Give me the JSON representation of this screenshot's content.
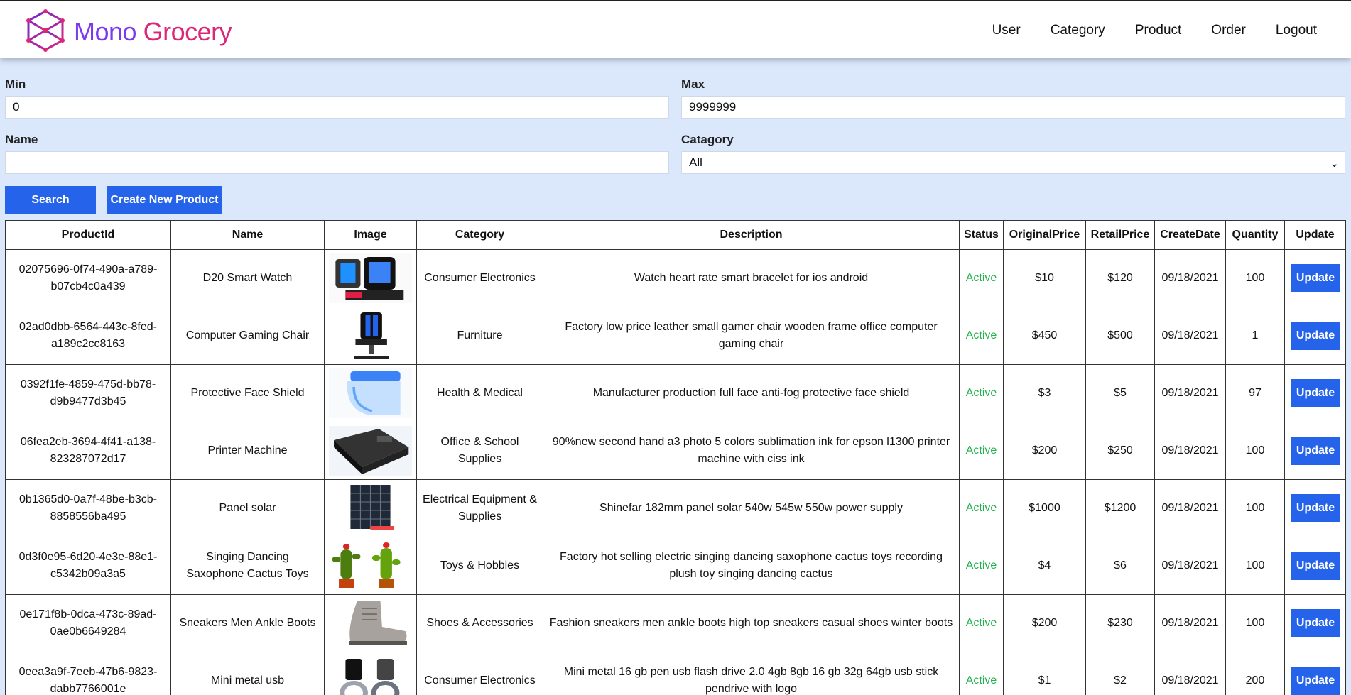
{
  "brand": {
    "part1": "Mono",
    "part2": "Grocery"
  },
  "nav": [
    "User",
    "Category",
    "Product",
    "Order",
    "Logout"
  ],
  "filters": {
    "min_label": "Min",
    "min_value": "0",
    "max_label": "Max",
    "max_value": "9999999",
    "name_label": "Name",
    "name_value": "",
    "category_label": "Catagory",
    "category_value": "All"
  },
  "buttons": {
    "search": "Search",
    "create": "Create New Product"
  },
  "table": {
    "headers": [
      "ProductId",
      "Name",
      "Image",
      "Category",
      "Description",
      "Status",
      "OriginalPrice",
      "RetailPrice",
      "CreateDate",
      "Quantity",
      "Update"
    ],
    "update_label": "Update",
    "rows": [
      {
        "id": "02075696-0f74-490a-a789-b07cb4c0a439",
        "name": "D20 Smart Watch",
        "image": "smartwatch",
        "category": "Consumer Electronics",
        "description": "Watch heart rate smart bracelet for ios android",
        "status": "Active",
        "original": "$10",
        "retail": "$120",
        "date": "09/18/2021",
        "qty": "100"
      },
      {
        "id": "02ad0dbb-6564-443c-8fed-a189c2cc8163",
        "name": "Computer Gaming Chair",
        "image": "gaming-chair",
        "category": "Furniture",
        "description": "Factory low price leather small gamer chair wooden frame office computer gaming chair",
        "status": "Active",
        "original": "$450",
        "retail": "$500",
        "date": "09/18/2021",
        "qty": "1"
      },
      {
        "id": "0392f1fe-4859-475d-bb78-d9b9477d3b45",
        "name": "Protective Face Shield",
        "image": "face-shield",
        "category": "Health & Medical",
        "description": "Manufacturer production full face anti-fog protective face shield",
        "status": "Active",
        "original": "$3",
        "retail": "$5",
        "date": "09/18/2021",
        "qty": "97"
      },
      {
        "id": "06fea2eb-3694-4f41-a138-823287072d17",
        "name": "Printer Machine",
        "image": "printer",
        "category": "Office & School Supplies",
        "description": "90%new second hand a3 photo 5 colors sublimation ink for epson l1300 printer machine with ciss ink",
        "status": "Active",
        "original": "$200",
        "retail": "$250",
        "date": "09/18/2021",
        "qty": "100"
      },
      {
        "id": "0b1365d0-0a7f-48be-b3cb-8858556ba495",
        "name": "Panel solar",
        "image": "solar-panel",
        "category": "Electrical Equipment & Supplies",
        "description": "Shinefar 182mm panel solar 540w 545w 550w power supply",
        "status": "Active",
        "original": "$1000",
        "retail": "$1200",
        "date": "09/18/2021",
        "qty": "100"
      },
      {
        "id": "0d3f0e95-6d20-4e3e-88e1-c5342b09a3a5",
        "name": "Singing Dancing Saxophone Cactus Toys",
        "image": "cactus-toys",
        "category": "Toys & Hobbies",
        "description": "Factory hot selling electric singing dancing saxophone cactus toys recording plush toy singing dancing cactus",
        "status": "Active",
        "original": "$4",
        "retail": "$6",
        "date": "09/18/2021",
        "qty": "100"
      },
      {
        "id": "0e171f8b-0dca-473c-89ad-0ae0b6649284",
        "name": "Sneakers Men Ankle Boots",
        "image": "boots",
        "category": "Shoes & Accessories",
        "description": "Fashion sneakers men ankle boots high top sneakers casual shoes winter boots",
        "status": "Active",
        "original": "$200",
        "retail": "$230",
        "date": "09/18/2021",
        "qty": "100"
      },
      {
        "id": "0eea3a9f-7eeb-47b6-9823-dabb7766001e",
        "name": "Mini metal usb",
        "image": "usb-drive",
        "category": "Consumer Electronics",
        "description": "Mini metal 16 gb pen usb flash drive 2.0 4gb 8gb 16 gb 32g 64gb usb stick pendrive with logo",
        "status": "Active",
        "original": "$1",
        "retail": "$2",
        "date": "09/18/2021",
        "qty": "200"
      }
    ]
  }
}
